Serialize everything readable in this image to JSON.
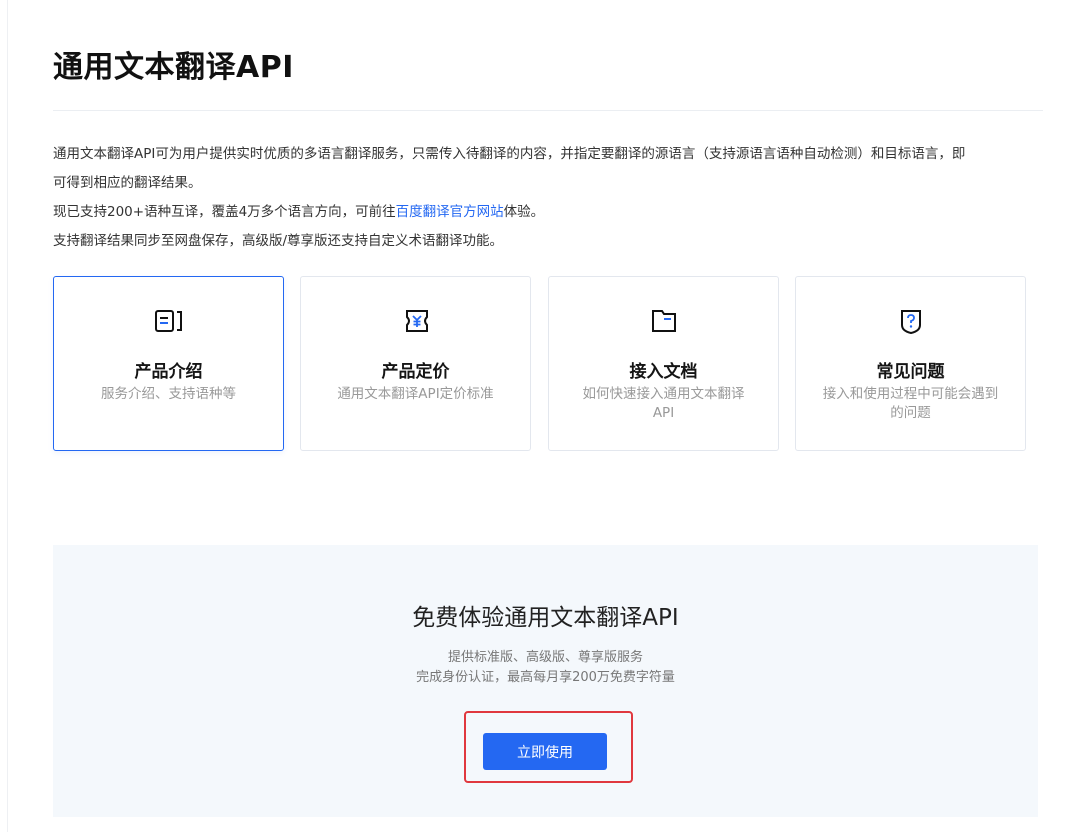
{
  "page": {
    "title": "通用文本翻译API",
    "intro": {
      "line1": "通用文本翻译API可为用户提供实时优质的多语言翻译服务，只需传入待翻译的内容，并指定要翻译的源语言（支持源语言语种自动检测）和目标语言，即",
      "line1_wrap": "可得到相应的翻译结果。",
      "line2_before": "现已支持200+语种互译，覆盖4万多个语言方向，可前往",
      "line2_link": "百度翻译官方网站",
      "line2_after": "体验。",
      "line3": "支持翻译结果同步至网盘保存，高级版/尊享版还支持自定义术语翻译功能。"
    }
  },
  "cards": [
    {
      "icon": "product-intro-icon",
      "title": "产品介绍",
      "desc": "服务介绍、支持语种等",
      "active": true
    },
    {
      "icon": "pricing-yen-icon",
      "title": "产品定价",
      "desc": "通用文本翻译API定价标准",
      "active": false
    },
    {
      "icon": "document-folder-icon",
      "title": "接入文档",
      "desc": "如何快速接入通用文本翻译API",
      "active": false
    },
    {
      "icon": "question-shield-icon",
      "title": "常见问题",
      "desc": "接入和使用过程中可能会遇到的问题",
      "active": false
    }
  ],
  "promo": {
    "title": "免费体验通用文本翻译API",
    "sub1": "提供标准版、高级版、尊享版服务",
    "sub2": "完成身份认证，最高每月享200万免费字符量",
    "button": "立即使用"
  },
  "colors": {
    "accent": "#2468f2",
    "highlight_frame": "#e0383e",
    "promo_bg": "#f4f8fc"
  }
}
